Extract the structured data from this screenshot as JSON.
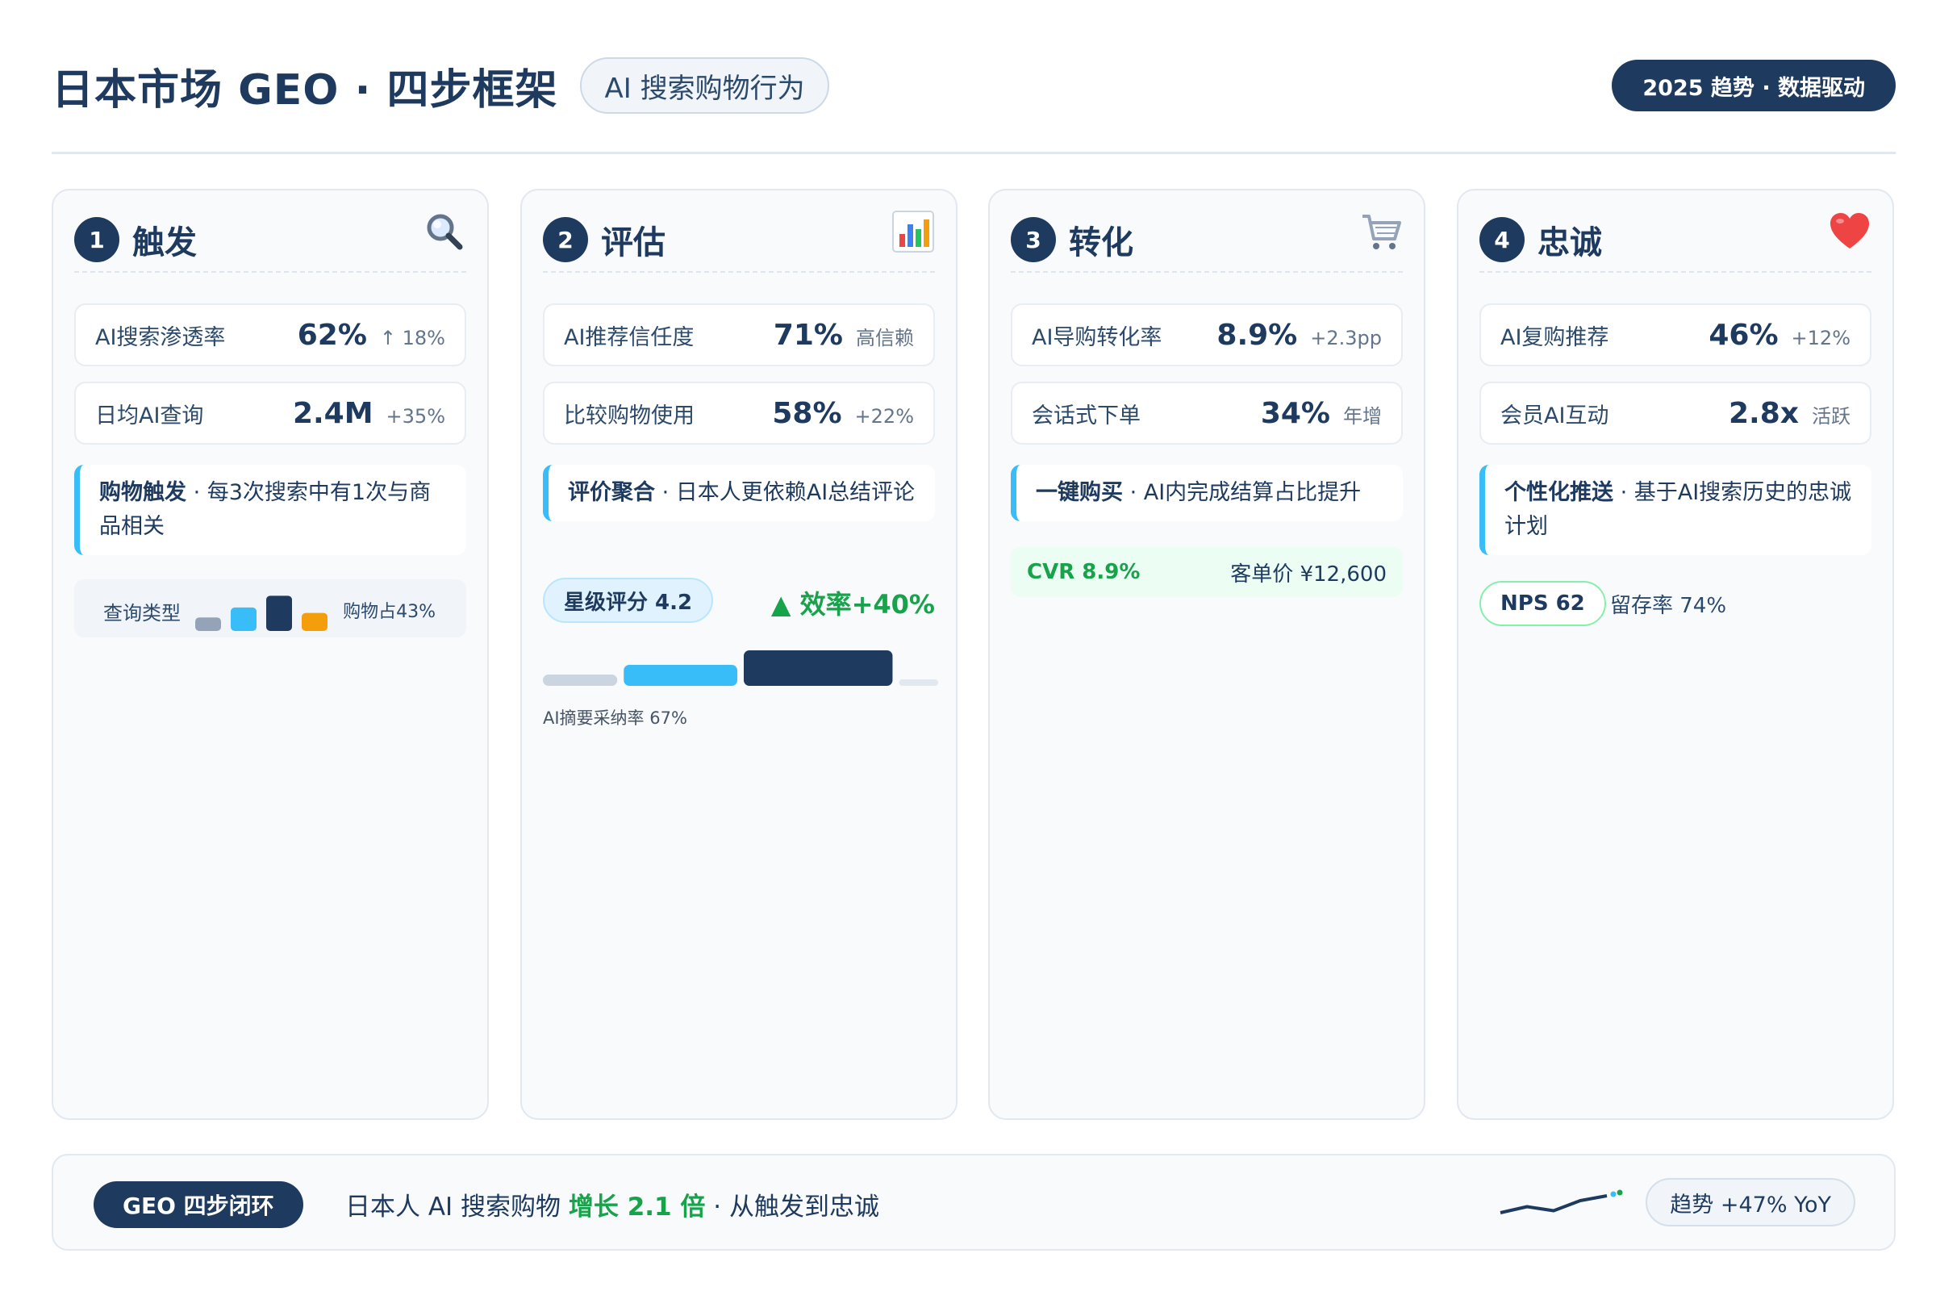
{
  "header": {
    "title": "日本市场 GEO · 四步框架",
    "subtitle": "AI 搜索购物行为",
    "badge": "2025 趋势 · 数据驱动"
  },
  "cards": [
    {
      "number": "1",
      "title": "触发",
      "icon": "magnifier-icon",
      "metrics": [
        {
          "label": "AI搜索渗透率",
          "value": "62%",
          "delta": "↑ 18%"
        },
        {
          "label": "日均AI查询",
          "value": "2.4M",
          "delta": "+35%"
        }
      ],
      "note": {
        "strong": "购物触发",
        "text": "每3次搜索中有1次与商品相关"
      },
      "mini_chart": {
        "left_label": "查询类型",
        "right_label": "购物占43%",
        "values": [
          0.3,
          0.52,
          0.78,
          0.4
        ],
        "colors": [
          "#94a3b8",
          "#38bdf8",
          "#1e3a5f",
          "#f59e0b"
        ]
      }
    },
    {
      "number": "2",
      "title": "评估",
      "icon": "bar-chart-icon",
      "metrics": [
        {
          "label": "AI推荐信任度",
          "value": "71%",
          "delta": "高信赖"
        },
        {
          "label": "比较购物使用",
          "value": "58%",
          "delta": "+22%"
        }
      ],
      "note": {
        "strong": "评价聚合",
        "text": "日本人更依赖AI总结评论"
      },
      "pill": "星级评分 4.2",
      "efficiency": "▲ 效率+40%",
      "caption": "AI摘要采纳率 67%",
      "progress": [
        0.19,
        0.29,
        0.38,
        0.1
      ]
    },
    {
      "number": "3",
      "title": "转化",
      "icon": "cart-icon",
      "metrics": [
        {
          "label": "AI导购转化率",
          "value": "8.9%",
          "delta": "+2.3pp"
        },
        {
          "label": "会话式下单",
          "value": "34%",
          "delta": "年增"
        }
      ],
      "note": {
        "strong": "一键购买",
        "text": "AI内完成结算占比提升"
      },
      "cvr_left": "CVR 8.9%",
      "cvr_right": "客单价 ¥12,600"
    },
    {
      "number": "4",
      "title": "忠诚",
      "icon": "heart-icon",
      "metrics": [
        {
          "label": "AI复购推荐",
          "value": "46%",
          "delta": "+12%"
        },
        {
          "label": "会员AI互动",
          "value": "2.8x",
          "delta": "活跃"
        }
      ],
      "note": {
        "strong": "个性化推送",
        "text": "基于AI搜索历史的忠诚计划"
      },
      "pill": "NPS 62",
      "side_text": "留存率 74%"
    }
  ],
  "footer": {
    "pill": "GEO 四步闭环",
    "text_before": "日本人 AI 搜索购物 ",
    "highlight": "增长 2.1 倍",
    "text_after": " · 从触发到忠诚",
    "trend": "趋势 +47% YoY",
    "sparkline": [
      0.3,
      0.45,
      0.35,
      0.6,
      0.72
    ]
  },
  "colors": {
    "navy": "#1e3a5f",
    "sky": "#38bdf8",
    "green": "#16a34a",
    "amber": "#f59e0b",
    "slate": "#94a3b8"
  }
}
